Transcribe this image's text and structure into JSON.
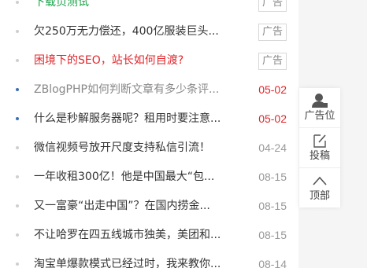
{
  "news": [
    {
      "title": "下载页测试",
      "tag": "广告",
      "color": "green",
      "bullet": "gray"
    },
    {
      "title": "欠250万无力偿还，400亿服装巨头...",
      "tag": "广告",
      "color": "normal",
      "bullet": "gray"
    },
    {
      "title": "困境下的SEO，站长如何自渡?",
      "tag": "广告",
      "color": "red",
      "bullet": "gray"
    },
    {
      "title": "ZBlogPHP如何判断文章有多少条评...",
      "date": "05-02",
      "dateRed": true,
      "color": "gray",
      "bullet": "blue"
    },
    {
      "title": "什么是秒解服务器呢？租用时要注意...",
      "date": "05-02",
      "dateRed": true,
      "color": "normal",
      "bullet": "blue"
    },
    {
      "title": "微信视频号放开尺度支持私信引流！",
      "date": "04-24",
      "color": "normal",
      "bullet": "gray"
    },
    {
      "title": "一年收租300亿！他是中国最大“包...",
      "date": "08-15",
      "color": "normal",
      "bullet": "gray"
    },
    {
      "title": "又一富豪“出走中国”？在国内捞金...",
      "date": "08-15",
      "color": "normal",
      "bullet": "gray"
    },
    {
      "title": "不让哈罗在四五线城市独美，美团和...",
      "date": "08-15",
      "color": "normal",
      "bullet": "gray"
    },
    {
      "title": "淘宝单爆款模式已经过时，我来教你...",
      "date": "08-14",
      "color": "normal",
      "bullet": "gray"
    }
  ],
  "sidebar": {
    "ad_label": "广告位",
    "submit_label": "投稿",
    "top_label": "顶部"
  },
  "colors": {
    "red": "#e0262b",
    "green": "#1aa34a",
    "bullet_blue": "#3b6fb6"
  }
}
